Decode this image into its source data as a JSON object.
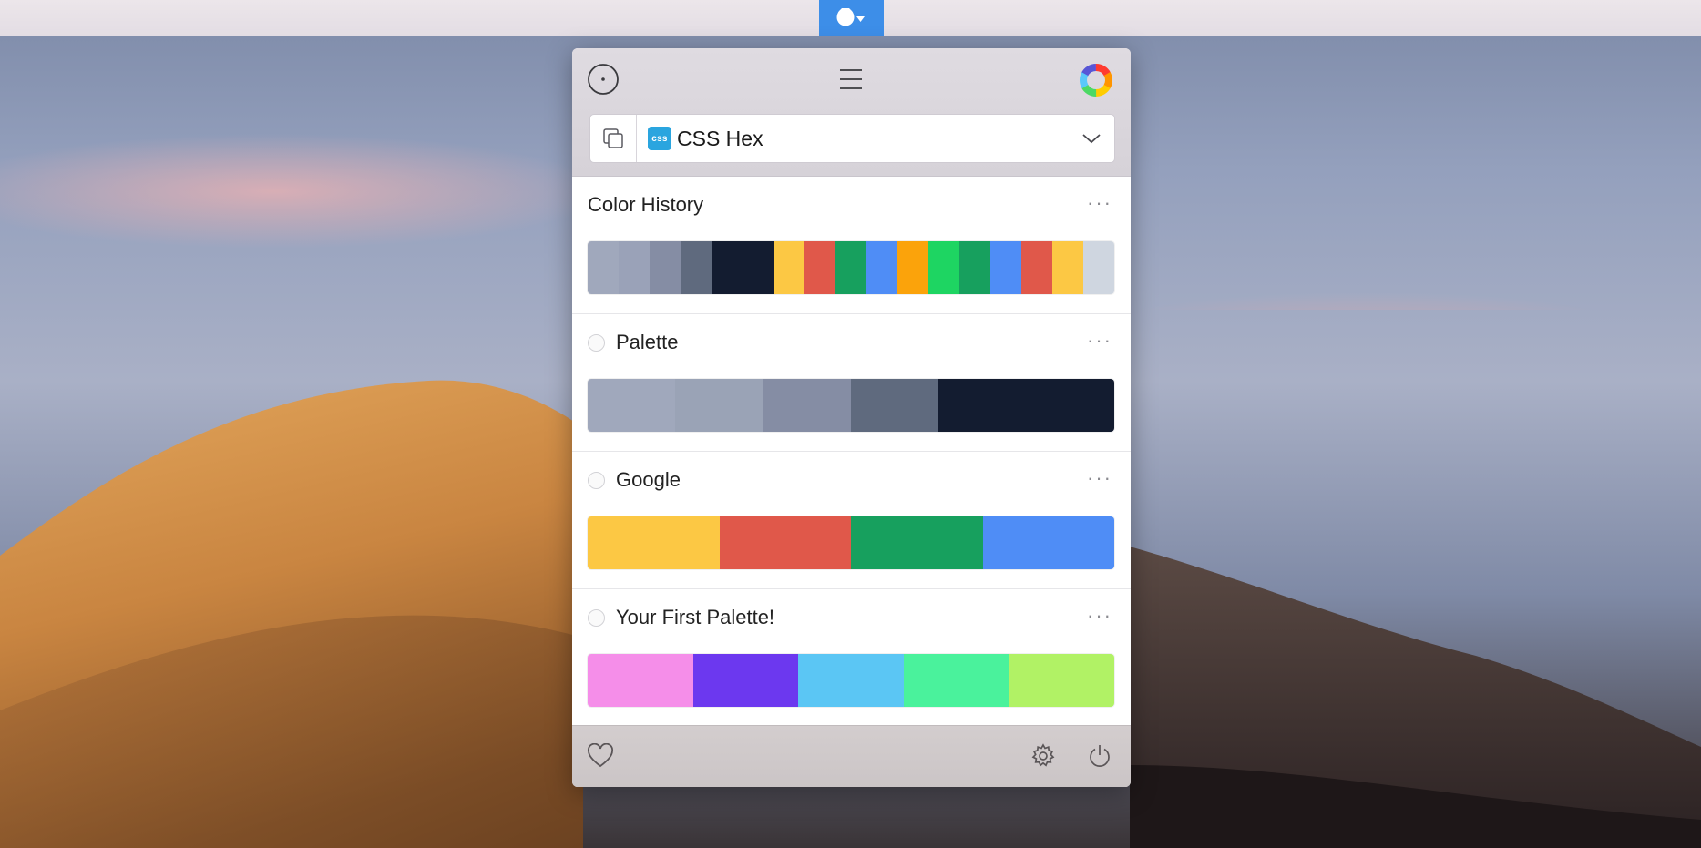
{
  "format": {
    "label": "CSS Hex",
    "badge": "css"
  },
  "sections": [
    {
      "title": "Color History",
      "has_radio": false,
      "more": "···",
      "colors": [
        {
          "hex": "#a0a8bc",
          "w": 3
        },
        {
          "hex": "#9aa2b8",
          "w": 3
        },
        {
          "hex": "#858da4",
          "w": 3
        },
        {
          "hex": "#5f6a7e",
          "w": 3
        },
        {
          "hex": "#131c30",
          "w": 6
        },
        {
          "hex": "#fcc844",
          "w": 3
        },
        {
          "hex": "#e0584a",
          "w": 3
        },
        {
          "hex": "#17a05e",
          "w": 3
        },
        {
          "hex": "#4f8df6",
          "w": 3
        },
        {
          "hex": "#fba30b",
          "w": 3
        },
        {
          "hex": "#1ed562",
          "w": 3
        },
        {
          "hex": "#17a05e",
          "w": 3
        },
        {
          "hex": "#4f8df6",
          "w": 3
        },
        {
          "hex": "#e0584a",
          "w": 3
        },
        {
          "hex": "#fcc844",
          "w": 3
        },
        {
          "hex": "#cfd6e0",
          "w": 3
        }
      ]
    },
    {
      "title": "Palette",
      "has_radio": true,
      "more": "···",
      "colors": [
        {
          "hex": "#a0a8bc",
          "w": 1
        },
        {
          "hex": "#9aa3b6",
          "w": 1
        },
        {
          "hex": "#858da4",
          "w": 1
        },
        {
          "hex": "#5f6a7e",
          "w": 1
        },
        {
          "hex": "#131c30",
          "w": 2
        }
      ]
    },
    {
      "title": "Google",
      "has_radio": true,
      "more": "···",
      "colors": [
        {
          "hex": "#fcc844",
          "w": 1
        },
        {
          "hex": "#e0584a",
          "w": 1
        },
        {
          "hex": "#17a05e",
          "w": 1
        },
        {
          "hex": "#4f8df6",
          "w": 1
        }
      ]
    },
    {
      "title": "Your First Palette!",
      "has_radio": true,
      "more": "···",
      "colors": [
        {
          "hex": "#f58ee9",
          "w": 1
        },
        {
          "hex": "#6c38ef",
          "w": 1
        },
        {
          "hex": "#5bc6f4",
          "w": 1
        },
        {
          "hex": "#4af29c",
          "w": 1
        },
        {
          "hex": "#b1f265",
          "w": 1
        }
      ]
    }
  ],
  "icons": {
    "menubar": "eyedropper-app-icon",
    "picker": "color-picker-icon",
    "menu": "hamburger-menu-icon",
    "wheel": "color-wheel-icon",
    "copy": "copy-icon",
    "chevron": "chevron-down-icon",
    "favorite": "heart-icon",
    "settings": "gear-icon",
    "power": "power-icon"
  }
}
